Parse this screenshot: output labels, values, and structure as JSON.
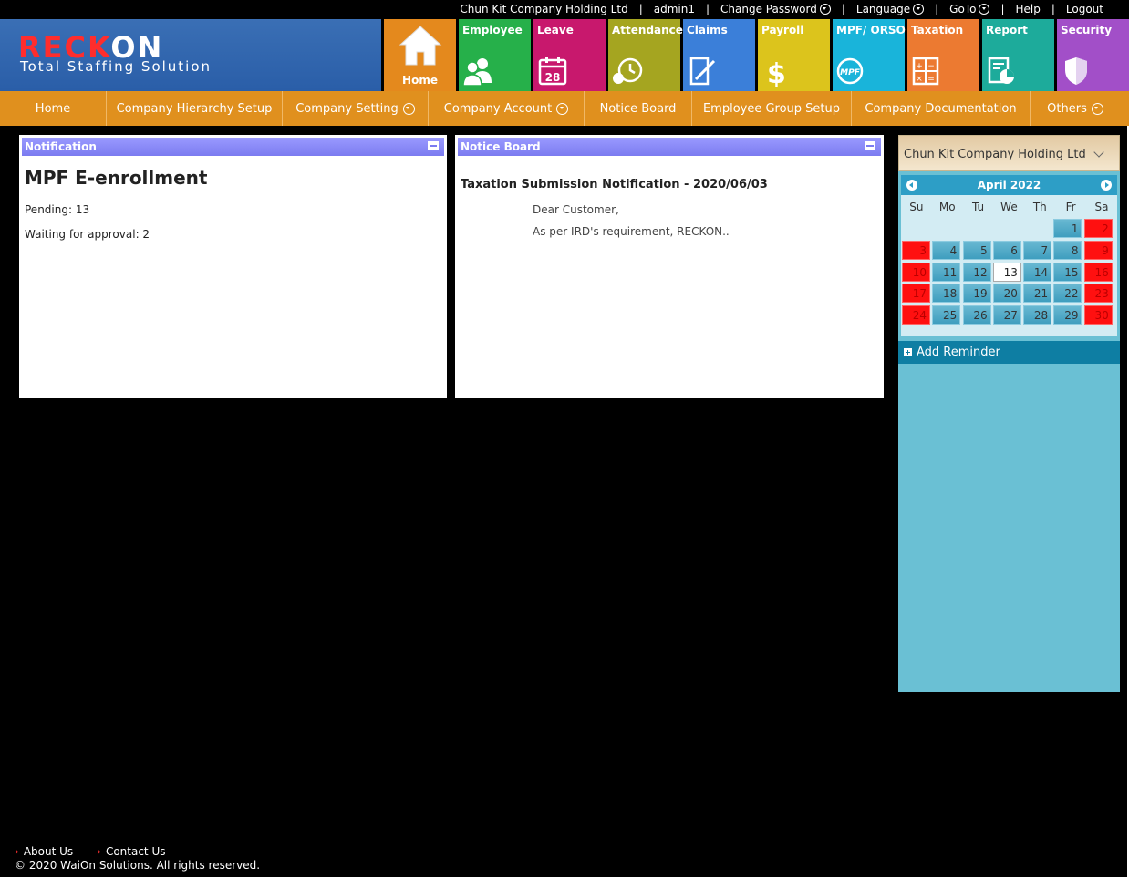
{
  "topbar": {
    "company": "Chun Kit Company Holding Ltd",
    "user": "admin1",
    "change_password": "Change Password",
    "language": "Language",
    "goto": "GoTo",
    "help": "Help",
    "logout": "Logout"
  },
  "logo": {
    "brand_left": "RECK",
    "brand_right": "ON",
    "tagline": "Total Staffing Solution"
  },
  "modules": [
    {
      "label": "Home",
      "color": "#e4891d",
      "icon": "house-icon"
    },
    {
      "label": "Employee",
      "color": "#26b04a",
      "icon": "people-icon"
    },
    {
      "label": "Leave",
      "color": "#c8186d",
      "icon": "calendar-icon",
      "icon_text": "28"
    },
    {
      "label": "Attendance",
      "color": "#a5a520",
      "icon": "clock-icon"
    },
    {
      "label": "Claims",
      "color": "#3b7fd9",
      "icon": "document-pen-icon"
    },
    {
      "label": "Payroll",
      "color": "#dcc41c",
      "icon": "dollar-icon"
    },
    {
      "label": "MPF/ ORSO",
      "color": "#19b4da",
      "icon": "mpf-icon",
      "icon_text": "MPF"
    },
    {
      "label": "Taxation",
      "color": "#ec7a31",
      "icon": "calculator-icon"
    },
    {
      "label": "Report",
      "color": "#1dab9b",
      "icon": "report-chart-icon"
    },
    {
      "label": "Security",
      "color": "#a24fc8",
      "icon": "shield-icon"
    }
  ],
  "nav": [
    {
      "label": "Home",
      "dropdown": false
    },
    {
      "label": "Company Hierarchy Setup",
      "dropdown": false
    },
    {
      "label": "Company Setting",
      "dropdown": true
    },
    {
      "label": "Company Account",
      "dropdown": true
    },
    {
      "label": "Notice Board",
      "dropdown": false
    },
    {
      "label": "Employee Group Setup",
      "dropdown": false
    },
    {
      "label": "Company Documentation",
      "dropdown": false
    },
    {
      "label": "Others",
      "dropdown": true
    }
  ],
  "notification": {
    "header": "Notification",
    "title": "MPF E-enrollment",
    "pending": "Pending: 13",
    "waiting": "Waiting for approval: 2"
  },
  "notice_board": {
    "header": "Notice Board",
    "title": "Taxation Submission Notification - 2020/06/03",
    "line1": "Dear Customer,",
    "line2": "As per IRD's requirement, RECKON.."
  },
  "sidebar": {
    "company_select": "Chun Kit Company Holding Ltd",
    "calendar": {
      "month_label": "April 2022",
      "dows": [
        "Su",
        "Mo",
        "Tu",
        "We",
        "Th",
        "Fr",
        "Sa"
      ],
      "first_weekday": 5,
      "days_in_month": 30,
      "today": 13,
      "red_days": [
        2,
        3,
        9,
        10,
        16,
        17,
        23,
        24,
        30
      ]
    },
    "add_reminder": "Add Reminder"
  },
  "footer": {
    "about": "About Us",
    "contact": "Contact Us",
    "copyright": "© 2020 WaiOn Solutions. All rights reserved."
  }
}
